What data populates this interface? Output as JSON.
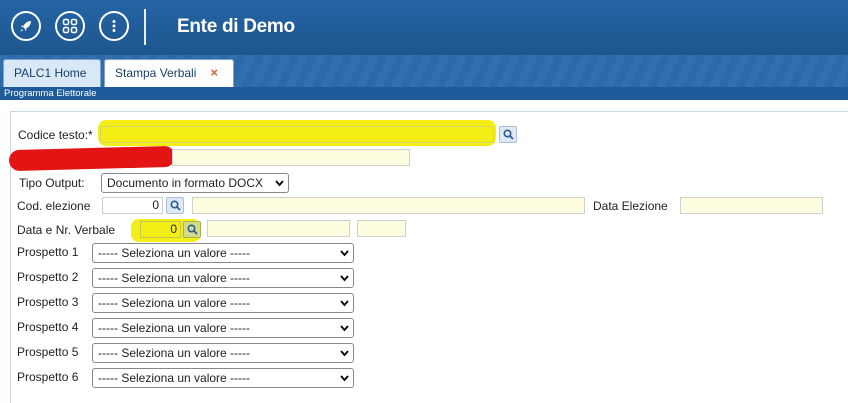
{
  "app": {
    "title": "Ente di Demo"
  },
  "tabs": [
    {
      "label": "PALC1 Home"
    },
    {
      "label": "Stampa Verbali",
      "close": "×"
    }
  ],
  "section": {
    "title": "Programma Elettorale"
  },
  "form": {
    "codice_testo_label": "Codice testo:*",
    "codice_testo_value": "",
    "descrizione_value": "",
    "tipo_output_label": "Tipo Output:",
    "tipo_output_selected": "Documento in formato DOCX",
    "cod_elezione_label": "Cod. elezione",
    "cod_elezione_value": "0",
    "cod_elezione_desc": "",
    "data_elezione_label": "Data Elezione",
    "data_elezione_value": "",
    "data_nr_verbale_label": "Data e Nr. Verbale",
    "data_nr_verbale_value": "0",
    "verbale_desc": "",
    "verbale_extra": "",
    "prospetti": [
      {
        "label": "Prospetto 1",
        "selected": "----- Seleziona un valore -----"
      },
      {
        "label": "Prospetto 2",
        "selected": "----- Seleziona un valore -----"
      },
      {
        "label": "Prospetto 3",
        "selected": "----- Seleziona un valore -----"
      },
      {
        "label": "Prospetto 4",
        "selected": "----- Seleziona un valore -----"
      },
      {
        "label": "Prospetto 5",
        "selected": "----- Seleziona un valore -----"
      },
      {
        "label": "Prospetto 6",
        "selected": "----- Seleziona un valore -----"
      }
    ]
  },
  "icons": {
    "rocket": "rocket-icon",
    "grid": "grid-icon",
    "more": "more-vertical-icon",
    "search": "search-icon",
    "chevron": "chevron-down-icon"
  },
  "colors": {
    "header": "#1f5b9a",
    "input_bg": "#fffde0",
    "highlight": "#f2ee00",
    "redaction": "#e31414"
  }
}
